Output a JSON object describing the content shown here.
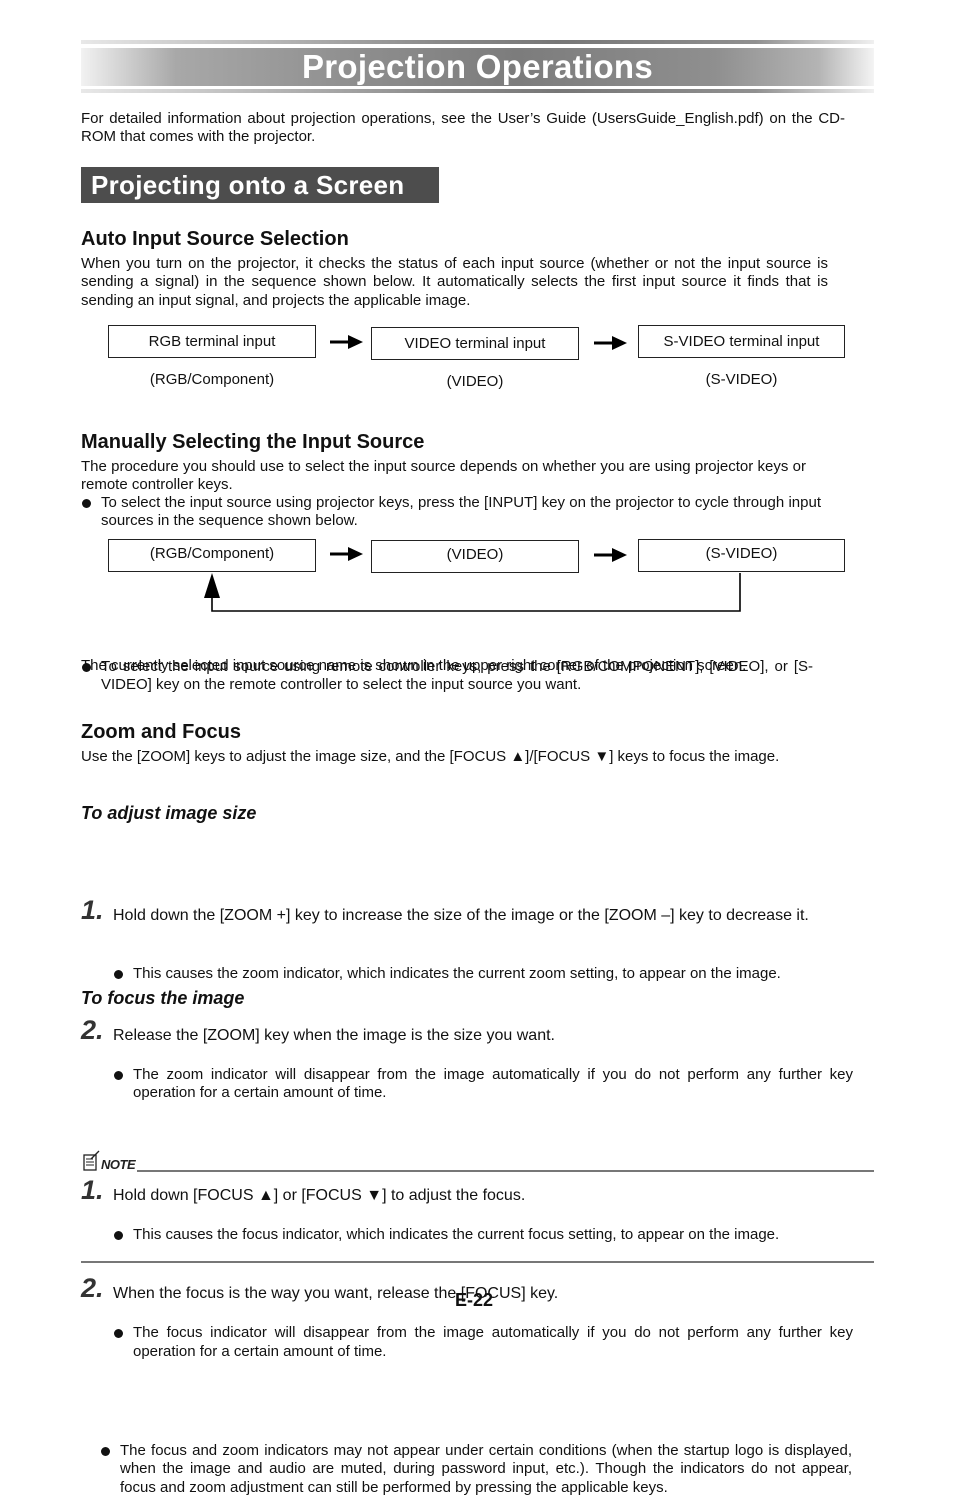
{
  "header": {
    "title": "Projection Operations"
  },
  "intro": "For detailed information about projection operations, see the User’s Guide (UsersGuide_English.pdf) on the CD-ROM that comes with the projector.",
  "section": {
    "title": "Projecting onto a Screen"
  },
  "auto_input": {
    "heading": "Auto Input Source Selection",
    "body": "When you turn on the projector, it checks the status of each input source (whether or not the input source is sending a signal) in the sequence shown below. It automatically selects the first input source it finds that is sending an input signal, and projects the applicable image.",
    "flow": [
      {
        "box": "RGB terminal input",
        "caption": "(RGB/Component)"
      },
      {
        "box": "VIDEO terminal input",
        "caption": "(VIDEO)"
      },
      {
        "box": "S-VIDEO terminal input",
        "caption": "(S-VIDEO)"
      }
    ]
  },
  "manual_input": {
    "heading": "Manually Selecting the Input Source",
    "body": "The procedure you should use to select the input source depends on whether you are using projector keys or remote controller keys.",
    "bullet1": "To select the input source using projector keys, press the [INPUT] key on the projector to cycle through input sources in the sequence shown below.",
    "flow": [
      "(RGB/Component)",
      "(VIDEO)",
      "(S-VIDEO)"
    ],
    "bullet2": "To select the input source using remote controller keys, press the [RGB/COMPONENT], [VIDEO], or [S-VIDEO] key on the remote controller to select the input source you want.",
    "footer": "The currently selected input source name is shown in the upper right corner of the projection screen."
  },
  "zoom_focus": {
    "heading": "Zoom and Focus",
    "body": "Use the [ZOOM] keys to adjust the image size, and the [FOCUS ▲]/[FOCUS ▼] keys to focus the image.",
    "size": {
      "heading": "To adjust image size",
      "steps": [
        {
          "num": "1.",
          "text": "Hold down the [ZOOM +] key to increase the size of the image or the [ZOOM –] key to decrease it.",
          "bullet": "This causes the zoom indicator, which indicates the current zoom setting, to appear on the image."
        },
        {
          "num": "2.",
          "text": "Release the [ZOOM] key when the image is the size you want.",
          "bullet": "The zoom indicator will disappear from the image automatically if you do not perform any further key operation for a certain amount of time."
        }
      ]
    },
    "focus": {
      "heading": "To focus the image",
      "steps": [
        {
          "num": "1.",
          "text": "Hold down [FOCUS ▲] or [FOCUS ▼] to adjust the focus.",
          "bullet": "This causes the focus indicator, which indicates the current focus setting, to appear on the image."
        },
        {
          "num": "2.",
          "text": "When the focus is the way you want, release the [FOCUS] key.",
          "bullet": "The focus indicator will disappear from the image automatically if you do not perform any further key operation for a certain amount of time."
        }
      ]
    }
  },
  "note": {
    "label": "NOTE",
    "icon": "note-icon",
    "text": "The focus and zoom indicators may not appear under certain conditions (when the startup logo is displayed, when the image and audio are muted, during password input, etc.). Though the indicators do not appear, focus and zoom adjustment can still be performed by pressing the applicable keys."
  },
  "page_number": "E-22"
}
